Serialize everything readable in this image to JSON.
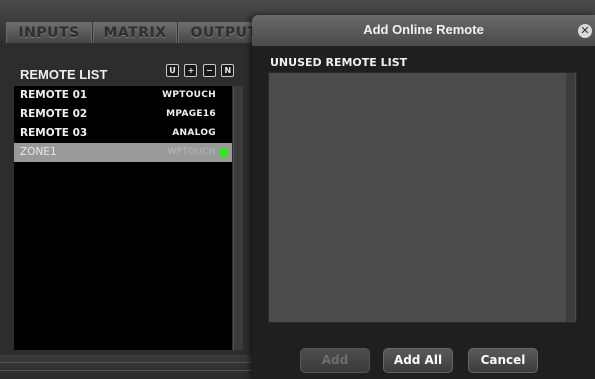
{
  "tabs": [
    {
      "label": "INPUTS"
    },
    {
      "label": "MATRIX"
    },
    {
      "label": "OUTPUT"
    }
  ],
  "remote_list": {
    "header": "REMOTE LIST",
    "header_buttons": [
      {
        "label": "U",
        "icon": "u-icon"
      },
      {
        "label": "+",
        "icon": "plus-icon"
      },
      {
        "label": "−",
        "icon": "minus-icon"
      },
      {
        "label": "N",
        "icon": "n-icon"
      }
    ],
    "items": [
      {
        "name": "REMOTE 01",
        "type": "WPTOUCH"
      },
      {
        "name": "REMOTE 02",
        "type": "MPAGE16"
      },
      {
        "name": "REMOTE 03",
        "type": "ANALOG"
      },
      {
        "name": "ZONE1",
        "type": "WPTOUCH",
        "selected": true,
        "online": true
      }
    ]
  },
  "dialog": {
    "title": "Add Online Remote",
    "close_icon": "close-icon",
    "section_label": "UNUSED REMOTE LIST",
    "buttons": {
      "add": "Add",
      "add_all": "Add All",
      "cancel": "Cancel"
    }
  },
  "colors": {
    "online_indicator": "#37e02a",
    "selected_row": "#9a9a9a"
  }
}
